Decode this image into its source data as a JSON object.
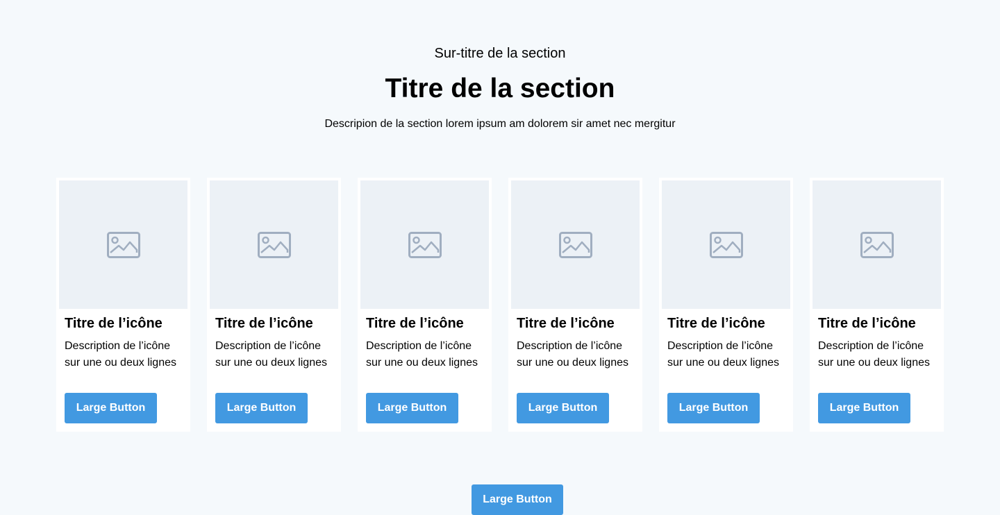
{
  "section": {
    "overline": "Sur-titre de la section",
    "title": "Titre de la section",
    "description": "Descripion de la section lorem ipsum am dolorem sir amet nec mergitur"
  },
  "cards": [
    {
      "title": "Titre de l’icône",
      "description": "Description de l’icône sur une ou deux lignes",
      "button_label": "Large Button",
      "image_icon": "image-placeholder-icon"
    },
    {
      "title": "Titre de l’icône",
      "description": "Description de l’icône sur une ou deux lignes",
      "button_label": "Large Button",
      "image_icon": "image-placeholder-icon"
    },
    {
      "title": "Titre de l’icône",
      "description": "Description de l’icône sur une ou deux lignes",
      "button_label": "Large Button",
      "image_icon": "image-placeholder-icon"
    },
    {
      "title": "Titre de l’icône",
      "description": "Description de l’icône sur une ou deux lignes",
      "button_label": "Large Button",
      "image_icon": "image-placeholder-icon"
    },
    {
      "title": "Titre de l’icône",
      "description": "Description de l’icône sur une ou deux lignes",
      "button_label": "Large Button",
      "image_icon": "image-placeholder-icon"
    },
    {
      "title": "Titre de l’icône",
      "description": "Description de l’icône sur une ou deux lignes",
      "button_label": "Large Button",
      "image_icon": "image-placeholder-icon"
    }
  ],
  "footer": {
    "button_label": "Large Button"
  },
  "colors": {
    "page_background": "#F5F9FC",
    "card_background": "#FFFFFF",
    "image_placeholder": "#ECF1F6",
    "icon": "#A0AEC0",
    "accent_button": "#4299E1"
  }
}
